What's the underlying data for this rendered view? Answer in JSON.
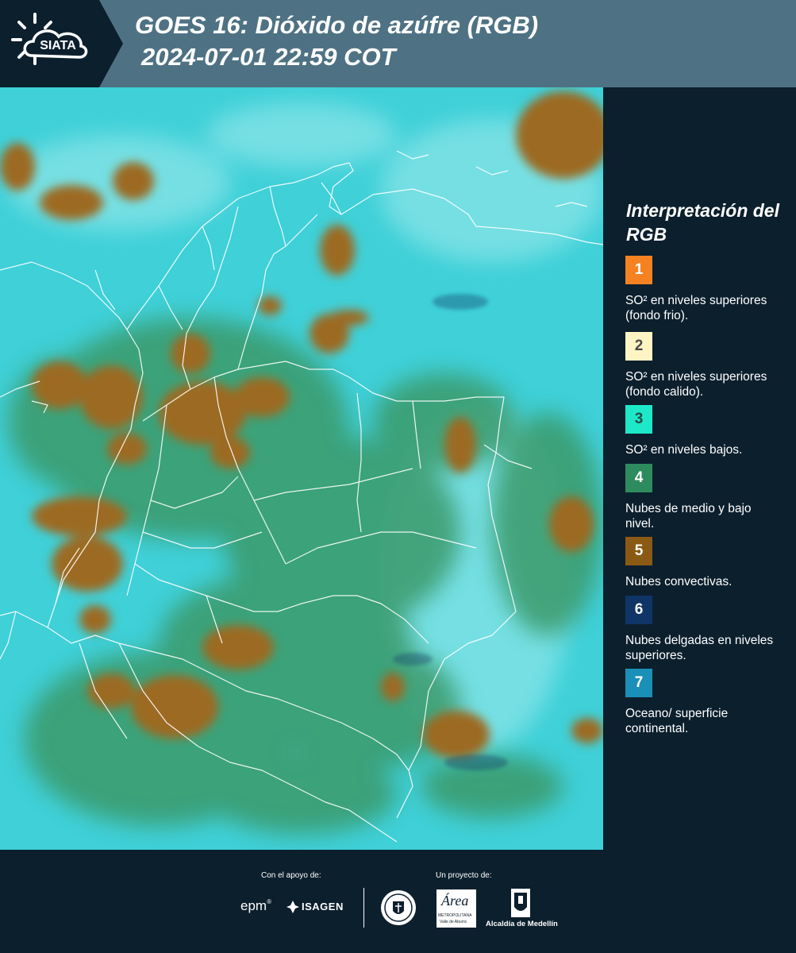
{
  "header": {
    "logo_text": "SIATA",
    "title_line1": "GOES 16: Dióxido de azúfre (RGB)",
    "title_line2": "2024-07-01 22:59 COT",
    "band_color": "#4e7283",
    "logo_bg_color": "#0c1f2d"
  },
  "legend": {
    "title": "Interpretación del RGB",
    "items": [
      {
        "number": "1",
        "label": "SO² en niveles superiores (fondo frio).",
        "color": "#f58220",
        "text_color": "#ffffff"
      },
      {
        "number": "2",
        "label": "SO² en niveles superiores (fondo calido).",
        "color": "#fff5c4",
        "text_color": "#4a4a4a"
      },
      {
        "number": "3",
        "label": "SO² en niveles bajos.",
        "color": "#1de9c8",
        "text_color": "#2b4a4a"
      },
      {
        "number": "4",
        "label": "Nubes de medio y bajo nivel.",
        "color": "#2e8b5e",
        "text_color": "#ffffff"
      },
      {
        "number": "5",
        "label": "Nubes convectivas.",
        "color": "#8a5a14",
        "text_color": "#ffffff"
      },
      {
        "number": "6",
        "label": "Nubes delgadas en niveles superiores.",
        "color": "#0f3566",
        "text_color": "#ffffff"
      },
      {
        "number": "7",
        "label": "Oceano/ superficie continental.",
        "color": "#1a8fb8",
        "text_color": "#ffffff"
      }
    ]
  },
  "footer": {
    "support_label": "Con el apoyo de:",
    "project_label": "Un proyecto de:",
    "epm_label": "epm",
    "isagen_label": "ISAGEN",
    "area_label": "Área",
    "metropolitana_label": "METROPOLITANA",
    "valle_label": "Valle de Aburrá",
    "alcaldia_label": "Alcaldía de Medellín"
  },
  "map": {
    "ocean_color": "#3fd0d8",
    "convective_color": "#9c6a22",
    "mid_cloud_color": "#3a9a6a",
    "border_color": "#ffffff"
  }
}
